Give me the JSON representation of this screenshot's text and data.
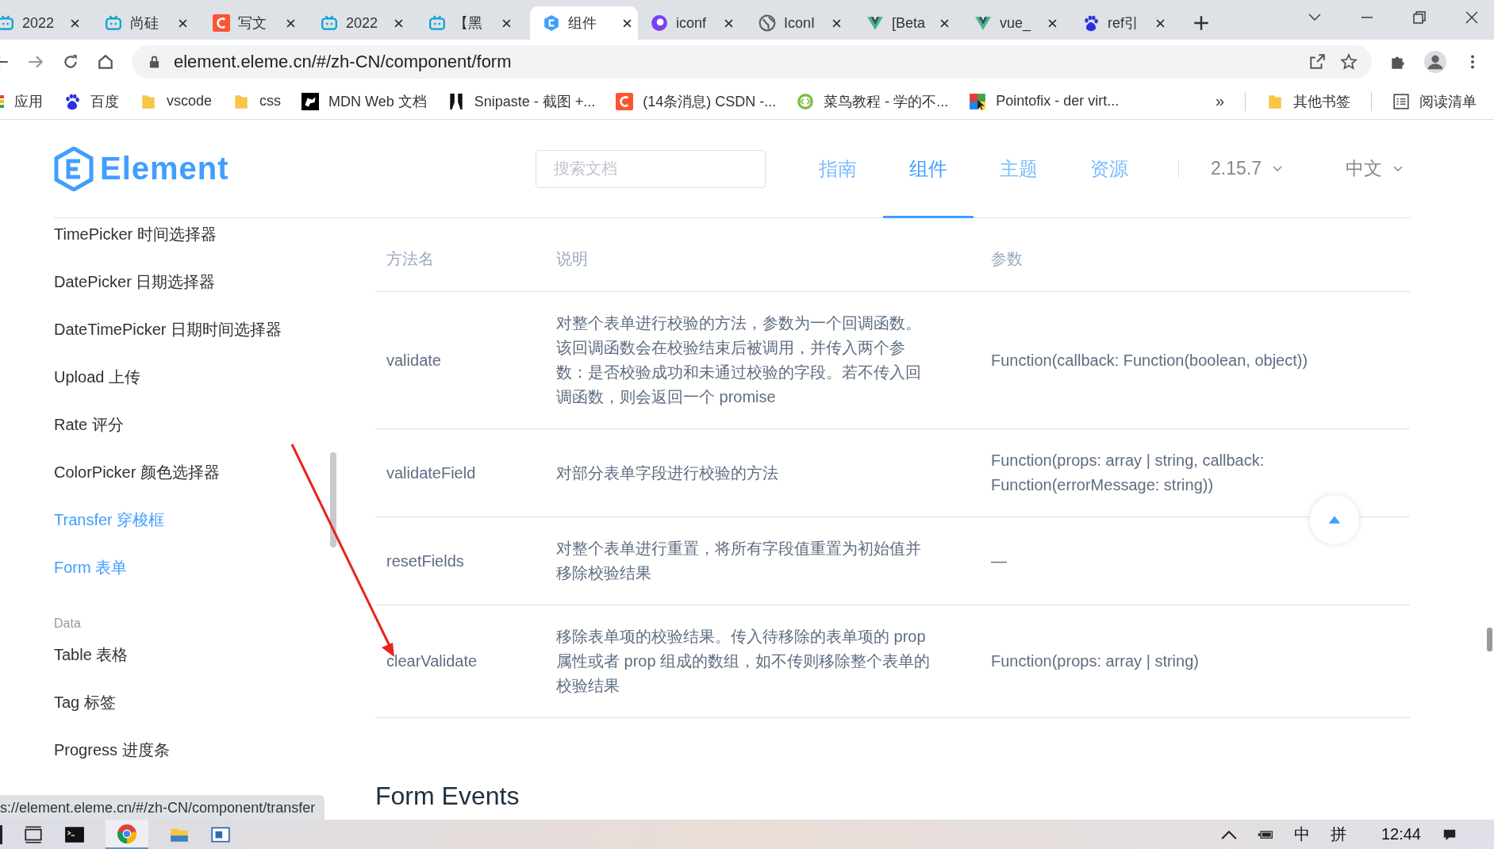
{
  "tabs": [
    {
      "title": "2022",
      "kind": "bili",
      "selected": false
    },
    {
      "title": "尚硅",
      "kind": "bili",
      "selected": false
    },
    {
      "title": "写文",
      "kind": "csdn",
      "selected": false
    },
    {
      "title": "2022",
      "kind": "bili",
      "selected": false
    },
    {
      "title": "【黑",
      "kind": "bili",
      "selected": false
    },
    {
      "title": "组件",
      "kind": "element",
      "selected": true
    },
    {
      "title": "iconf",
      "kind": "iconfont",
      "selected": false
    },
    {
      "title": "IconI",
      "kind": "globe",
      "selected": false
    },
    {
      "title": "[Beta",
      "kind": "vue",
      "selected": false
    },
    {
      "title": "vue_",
      "kind": "vue",
      "selected": false
    },
    {
      "title": "ref引",
      "kind": "baidu",
      "selected": false
    }
  ],
  "address": "element.eleme.cn/#/zh-CN/component/form",
  "bookmarks": [
    {
      "label": "应用",
      "kind": "apps"
    },
    {
      "label": "百度",
      "kind": "baidu"
    },
    {
      "label": "vscode",
      "kind": "folder"
    },
    {
      "label": "css",
      "kind": "folder"
    },
    {
      "label": "MDN Web 文档",
      "kind": "mdn"
    },
    {
      "label": "Snipaste - 截图 +...",
      "kind": "snipaste"
    },
    {
      "label": "(14条消息) CSDN -...",
      "kind": "csdn"
    },
    {
      "label": "菜鸟教程 - 学的不...",
      "kind": "runoob"
    },
    {
      "label": "Pointofix - der virt...",
      "kind": "pointofix"
    }
  ],
  "bookmarks_more": "»",
  "other_bookmarks": "其他书签",
  "reading_list": "阅读清单",
  "site": {
    "logo": "Element",
    "search_placeholder": "搜索文档",
    "nav": [
      {
        "label": "指南",
        "selected": false
      },
      {
        "label": "组件",
        "selected": true
      },
      {
        "label": "主题",
        "selected": false
      },
      {
        "label": "资源",
        "selected": false
      }
    ],
    "version": "2.15.7",
    "language": "中文"
  },
  "sidebar": [
    {
      "kind": "item",
      "label": "TimePicker 时间选择器",
      "selected": false
    },
    {
      "kind": "item",
      "label": "DatePicker 日期选择器",
      "selected": false
    },
    {
      "kind": "item",
      "label": "DateTimePicker 日期时间选择器",
      "selected": false
    },
    {
      "kind": "item",
      "label": "Upload 上传",
      "selected": false
    },
    {
      "kind": "item",
      "label": "Rate 评分",
      "selected": false
    },
    {
      "kind": "item",
      "label": "ColorPicker 颜色选择器",
      "selected": false
    },
    {
      "kind": "item",
      "label": "Transfer 穿梭框",
      "selected": true
    },
    {
      "kind": "item",
      "label": "Form 表单",
      "selected": true
    },
    {
      "kind": "group",
      "label": "Data"
    },
    {
      "kind": "item",
      "label": "Table 表格",
      "selected": false
    },
    {
      "kind": "item",
      "label": "Tag 标签",
      "selected": false
    },
    {
      "kind": "item",
      "label": "Progress 进度条",
      "selected": false
    }
  ],
  "table": {
    "columns": [
      "方法名",
      "说明",
      "参数"
    ],
    "rows": [
      [
        "validate",
        "对整个表单进行校验的方法，参数为一个回调函数。该回调函数会在校验结束后被调用，并传入两个参数：是否校验成功和未通过校验的字段。若不传入回调函数，则会返回一个 promise",
        "Function(callback: Function(boolean, object))"
      ],
      [
        "validateField",
        "对部分表单字段进行校验的方法",
        "Function(props: array | string, callback: Function(errorMessage: string))"
      ],
      [
        "resetFields",
        "对整个表单进行重置，将所有字段值重置为初始值并移除校验结果",
        "—"
      ],
      [
        "clearValidate",
        "移除表单项的校验结果。传入待移除的表单项的 prop 属性或者 prop 组成的数组，如不传则移除整个表单的校验结果",
        "Function(props: array | string)"
      ]
    ]
  },
  "section_heading": "Form Events",
  "status_url": "s://element.eleme.cn/#/zh-CN/component/transfer",
  "tray": {
    "ime": "中",
    "ime_mode": "拼",
    "time": "12:44"
  }
}
